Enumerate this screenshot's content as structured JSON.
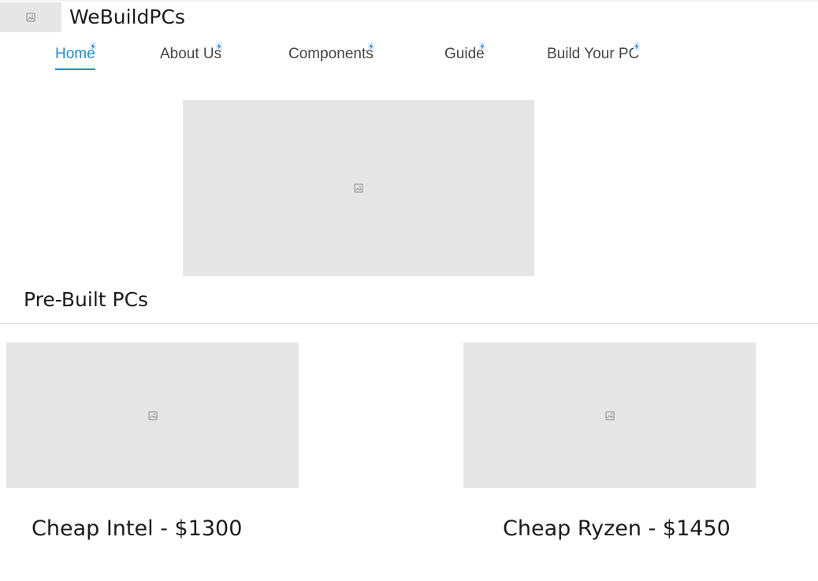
{
  "header": {
    "brand": "WeBuildPCs",
    "logo_icon": "image-placeholder-icon"
  },
  "nav": {
    "items": [
      {
        "label": "Home",
        "active": true
      },
      {
        "label": "About Us",
        "active": false
      },
      {
        "label": "Components",
        "active": false
      },
      {
        "label": "Guide",
        "active": false
      },
      {
        "label": "Build Your PC",
        "active": false
      }
    ],
    "active_color": "#1e88e5"
  },
  "hero": {
    "icon": "image-placeholder-icon"
  },
  "prebuilt": {
    "title": "Pre-Built PCs",
    "cards": [
      {
        "label": "Cheap Intel - $1300"
      },
      {
        "label": "Cheap Ryzen - $1450"
      }
    ]
  }
}
